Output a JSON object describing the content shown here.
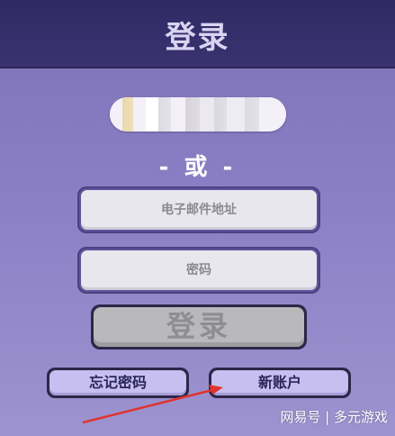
{
  "header": {
    "title": "登录"
  },
  "social_login": {
    "icon": "blurred-social-login-icons"
  },
  "divider": {
    "label": "- 或 -"
  },
  "form": {
    "email_placeholder": "电子邮件地址",
    "password_placeholder": "密码",
    "login_label": "登录"
  },
  "links": {
    "forgot_password_label": "忘记密码",
    "new_account_label": "新账户"
  },
  "watermark": {
    "text": "网易号 | 多元游戏"
  },
  "colors": {
    "header_bg": "#2f2964",
    "page_bg": "#8a7fc4",
    "button_face": "#c6bff0",
    "login_disabled": "#b9b9bb",
    "annotation_arrow": "#e0332e"
  }
}
